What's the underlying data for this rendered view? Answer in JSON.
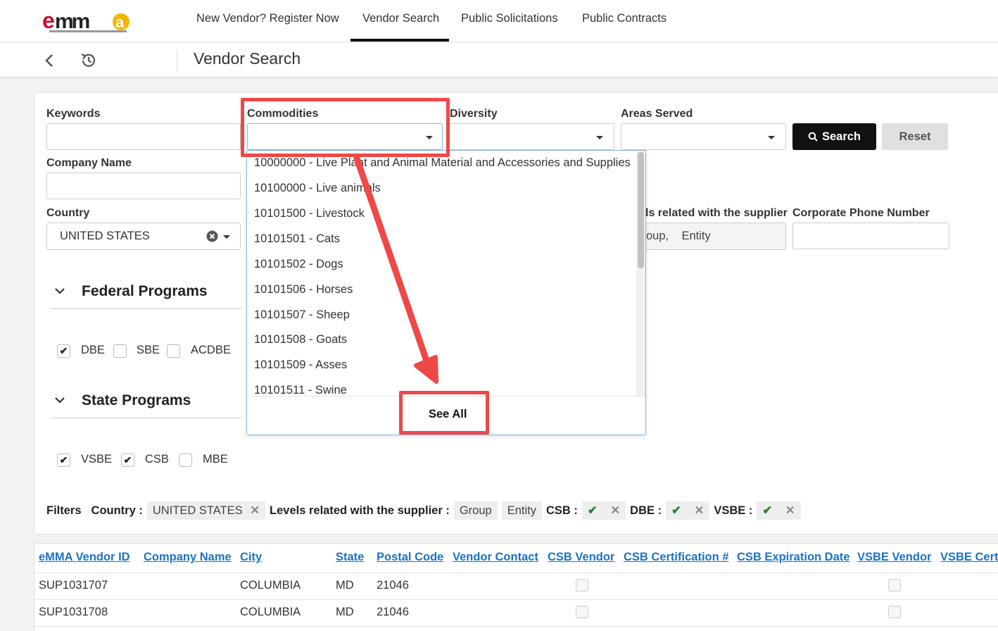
{
  "nav": {
    "items": [
      "New Vendor? Register Now",
      "Vendor Search",
      "Public Solicitations",
      "Public Contracts"
    ],
    "active": "Vendor Search"
  },
  "subheader": {
    "title": "Vendor Search"
  },
  "form": {
    "keywords_label": "Keywords",
    "commodities_label": "Commodities",
    "diversity_label": "Diversity",
    "areas_label": "Areas Served",
    "company_label": "Company Name",
    "country_label": "Country",
    "country_value": "UNITED STATES",
    "levels_label": "ls related with the supplier",
    "levels_value": "oup,    Entity",
    "phone_label": "Corporate Phone Number",
    "search_label": "Search",
    "reset_label": "Reset"
  },
  "federal": {
    "title": "Federal Programs",
    "options": [
      {
        "label": "DBE",
        "checked": true
      },
      {
        "label": "SBE",
        "checked": false
      },
      {
        "label": "ACDBE",
        "checked": false
      }
    ]
  },
  "state": {
    "title": "State Programs",
    "options": [
      {
        "label": "VSBE",
        "checked": true
      },
      {
        "label": "CSB",
        "checked": true
      },
      {
        "label": "MBE",
        "checked": false
      }
    ]
  },
  "filters": {
    "label": "Filters",
    "country_label": "Country :",
    "country_value": "UNITED STATES",
    "levels_label": "Levels related with the supplier :",
    "levels_values": [
      "Group",
      "Entity"
    ],
    "csb_label": "CSB :",
    "dbe_label": "DBE :",
    "vsbe_label": "VSBE :",
    "remove_glyph": "✕",
    "check_glyph": "✔"
  },
  "dropdown": {
    "items": [
      "10000000 - Live Plant and Animal Material and Accessories and Supplies",
      "10100000 - Live animals",
      "10101500 - Livestock",
      "10101501 - Cats",
      "10101502 - Dogs",
      "10101506 - Horses",
      "10101507 - Sheep",
      "10101508 - Goats",
      "10101509 - Asses",
      "10101511 - Swine"
    ],
    "see_all": "See All"
  },
  "table": {
    "headers": [
      "eMMA Vendor ID",
      "Company Name",
      "City",
      "State",
      "Postal Code",
      "Vendor Contact",
      "CSB Vendor",
      "CSB Certification #",
      "CSB Expiration Date",
      "VSBE Vendor",
      "VSBE Certi"
    ],
    "rows": [
      {
        "id": "SUP1031707",
        "company": "",
        "city": "COLUMBIA",
        "state": "MD",
        "postal": "21046"
      },
      {
        "id": "SUP1031708",
        "company": "",
        "city": "COLUMBIA",
        "state": "MD",
        "postal": "21046"
      }
    ]
  },
  "colors": {
    "accent_red": "#f04747",
    "link_blue": "#1a73c8",
    "check_green": "#2e7d32"
  }
}
